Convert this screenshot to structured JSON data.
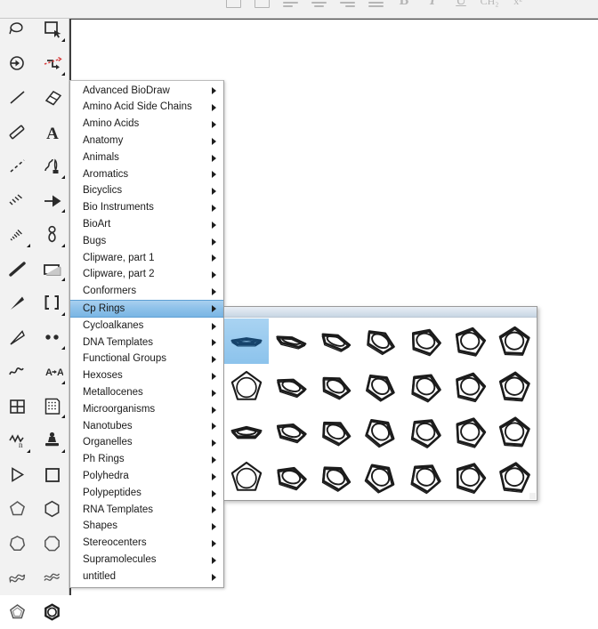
{
  "app": {
    "name": "ChemDraw",
    "accent_selection": "#8fc2ea",
    "menu_bg": "#ffffff",
    "palette_bg": "#f2f2f2"
  },
  "top_toolbar": {
    "name": "text-formatting-toolbar",
    "buttons": [
      {
        "name": "text-box-tool",
        "label": "",
        "icon": "rect-icon"
      },
      {
        "name": "text-box-tool-2",
        "label": "",
        "icon": "rect-icon"
      },
      {
        "name": "align-left-button",
        "label": "",
        "icon": "align-left-icon"
      },
      {
        "name": "align-center-button",
        "label": "",
        "icon": "align-center-icon"
      },
      {
        "name": "align-right-button",
        "label": "",
        "icon": "align-right-icon"
      },
      {
        "name": "align-justify-button",
        "label": "",
        "icon": "align-justify-icon"
      },
      {
        "name": "bold-button",
        "label": "B",
        "icon": "bold-icon"
      },
      {
        "name": "italic-button",
        "label": "I",
        "icon": "italic-icon"
      },
      {
        "name": "underline-button",
        "label": "U",
        "icon": "underline-icon"
      },
      {
        "name": "subscript-button",
        "label": "CH₂",
        "icon": "subscript-icon"
      },
      {
        "name": "superscript-button",
        "label": "x²",
        "icon": "superscript-icon"
      }
    ]
  },
  "left_palette": {
    "name": "main-tool-palette",
    "column_a": [
      {
        "name": "lasso-select-tool",
        "icon": "lasso-icon"
      },
      {
        "name": "structure-perspective-tool",
        "icon": "circle-arrow-icon"
      },
      {
        "name": "solid-bond-tool",
        "icon": "line-icon"
      },
      {
        "name": "multiple-bond-tool",
        "icon": "double-line-icon"
      },
      {
        "name": "dashed-bond-tool",
        "icon": "dashed-line-icon"
      },
      {
        "name": "hashed-bond-tool",
        "icon": "hash-bond-icon"
      },
      {
        "name": "hashed-wedge-bond-tool",
        "icon": "hashed-wedge-icon"
      },
      {
        "name": "bold-bond-tool",
        "icon": "bold-bond-icon"
      },
      {
        "name": "wedged-bond-tool",
        "icon": "wedge-bond-icon"
      },
      {
        "name": "hollow-wedge-bond-tool",
        "icon": "hollow-wedge-icon"
      },
      {
        "name": "wavy-bond-tool",
        "icon": "wavy-bond-icon"
      },
      {
        "name": "table-tool",
        "icon": "table-icon"
      },
      {
        "name": "chain-tool",
        "icon": "chain-icon"
      },
      {
        "name": "arrow-tool",
        "icon": "triangle-right-icon"
      },
      {
        "name": "pentagon-tool",
        "icon": "pentagon-icon"
      },
      {
        "name": "heptagon-tool",
        "icon": "heptagon-icon"
      },
      {
        "name": "ribbon-tool",
        "icon": "ribbon-icon"
      },
      {
        "name": "cyclopentane-tool",
        "icon": "cyclopentane-icon"
      }
    ],
    "column_b": [
      {
        "name": "marquee-select-tool",
        "icon": "marquee-icon"
      },
      {
        "name": "bond-rotate-tool",
        "icon": "rotate-bond-icon"
      },
      {
        "name": "eraser-tool",
        "icon": "eraser-icon"
      },
      {
        "name": "text-tool",
        "icon": "text-a-icon"
      },
      {
        "name": "pen-tool",
        "icon": "pen-icon"
      },
      {
        "name": "arrow-vector-tool",
        "icon": "arrow-icon"
      },
      {
        "name": "orbital-tool",
        "icon": "orbital-icon"
      },
      {
        "name": "bracket-rect-tool",
        "icon": "rectangle-icon"
      },
      {
        "name": "brackets-tool",
        "icon": "brackets-icon"
      },
      {
        "name": "query-dots-tool",
        "icon": "two-dots-icon"
      },
      {
        "name": "atom-label-tool",
        "icon": "a-to-a-icon"
      },
      {
        "name": "template-palette-tool",
        "icon": "template-sheet-icon"
      },
      {
        "name": "stamp-tool",
        "icon": "stamp-icon"
      },
      {
        "name": "square-tool",
        "icon": "square-icon"
      },
      {
        "name": "hexagon-tool",
        "icon": "hexagon-icon"
      },
      {
        "name": "octagon-tool",
        "icon": "octagon-icon"
      },
      {
        "name": "ribbon-flat-tool",
        "icon": "ribbon-flat-icon"
      },
      {
        "name": "benzene-tool",
        "icon": "benzene-icon"
      }
    ]
  },
  "templates_menu": {
    "name": "templates-menu",
    "selected": "Cp Rings",
    "items": [
      {
        "label": "Advanced BioDraw",
        "has_submenu": true
      },
      {
        "label": "Amino Acid Side Chains",
        "has_submenu": true
      },
      {
        "label": "Amino Acids",
        "has_submenu": true
      },
      {
        "label": "Anatomy",
        "has_submenu": true
      },
      {
        "label": "Animals",
        "has_submenu": true
      },
      {
        "label": "Aromatics",
        "has_submenu": true
      },
      {
        "label": "Bicyclics",
        "has_submenu": true
      },
      {
        "label": "Bio Instruments",
        "has_submenu": true
      },
      {
        "label": "BioArt",
        "has_submenu": true
      },
      {
        "label": "Bugs",
        "has_submenu": true
      },
      {
        "label": "Clipware, part 1",
        "has_submenu": true
      },
      {
        "label": "Clipware, part 2",
        "has_submenu": true
      },
      {
        "label": "Conformers",
        "has_submenu": true
      },
      {
        "label": "Cp Rings",
        "has_submenu": true
      },
      {
        "label": "Cycloalkanes",
        "has_submenu": true
      },
      {
        "label": "DNA Templates",
        "has_submenu": true
      },
      {
        "label": "Functional Groups",
        "has_submenu": true
      },
      {
        "label": "Hexoses",
        "has_submenu": true
      },
      {
        "label": "Metallocenes",
        "has_submenu": true
      },
      {
        "label": "Microorganisms",
        "has_submenu": true
      },
      {
        "label": "Nanotubes",
        "has_submenu": true
      },
      {
        "label": "Organelles",
        "has_submenu": true
      },
      {
        "label": "Ph Rings",
        "has_submenu": true
      },
      {
        "label": "Polyhedra",
        "has_submenu": true
      },
      {
        "label": "Polypeptides",
        "has_submenu": true
      },
      {
        "label": "RNA Templates",
        "has_submenu": true
      },
      {
        "label": "Shapes",
        "has_submenu": true
      },
      {
        "label": "Stereocenters",
        "has_submenu": true
      },
      {
        "label": "Supramolecules",
        "has_submenu": true
      },
      {
        "label": "untitled",
        "has_submenu": true
      }
    ]
  },
  "cp_submenu": {
    "name": "cp-rings-template-palette",
    "title": "",
    "selected_index": 0,
    "cells": [
      {
        "name": "cp-ring-0deg",
        "tilt": 78,
        "rot": 0,
        "selected": true
      },
      {
        "name": "cp-ring-a1",
        "tilt": 74,
        "rot": 14,
        "selected": false
      },
      {
        "name": "cp-ring-a2",
        "tilt": 64,
        "rot": 22,
        "selected": false
      },
      {
        "name": "cp-ring-a3",
        "tilt": 50,
        "rot": 32,
        "selected": false
      },
      {
        "name": "cp-ring-a4",
        "tilt": 36,
        "rot": 20,
        "selected": false
      },
      {
        "name": "cp-ring-a5",
        "tilt": 26,
        "rot": 12,
        "selected": false
      },
      {
        "name": "cp-ring-a6",
        "tilt": 20,
        "rot": 2,
        "selected": false
      },
      {
        "name": "cp-ring-b0",
        "tilt": 92,
        "rot": 0,
        "selected": false
      },
      {
        "name": "cp-ring-b1",
        "tilt": 60,
        "rot": 18,
        "selected": false
      },
      {
        "name": "cp-ring-b2",
        "tilt": 52,
        "rot": 26,
        "selected": false
      },
      {
        "name": "cp-ring-b3",
        "tilt": 40,
        "rot": 36,
        "selected": false
      },
      {
        "name": "cp-ring-b4",
        "tilt": 30,
        "rot": 26,
        "selected": false
      },
      {
        "name": "cp-ring-b5",
        "tilt": 24,
        "rot": 14,
        "selected": false
      },
      {
        "name": "cp-ring-b6",
        "tilt": 18,
        "rot": 4,
        "selected": false
      },
      {
        "name": "cp-ring-c0",
        "tilt": 70,
        "rot": 0,
        "selected": false
      },
      {
        "name": "cp-ring-c1",
        "tilt": 58,
        "rot": 16,
        "selected": false
      },
      {
        "name": "cp-ring-c2",
        "tilt": 46,
        "rot": 28,
        "selected": false
      },
      {
        "name": "cp-ring-c3",
        "tilt": 34,
        "rot": 40,
        "selected": false
      },
      {
        "name": "cp-ring-c4",
        "tilt": 26,
        "rot": 28,
        "selected": false
      },
      {
        "name": "cp-ring-c5",
        "tilt": 20,
        "rot": 16,
        "selected": false
      },
      {
        "name": "cp-ring-c6",
        "tilt": 16,
        "rot": 4,
        "selected": false
      },
      {
        "name": "cp-ring-d0",
        "tilt": 94,
        "rot": 0,
        "selected": false
      },
      {
        "name": "cp-ring-d1",
        "tilt": 48,
        "rot": 18,
        "selected": false
      },
      {
        "name": "cp-ring-d2",
        "tilt": 44,
        "rot": 30,
        "selected": false
      },
      {
        "name": "cp-ring-d3",
        "tilt": 30,
        "rot": 42,
        "selected": false
      },
      {
        "name": "cp-ring-d4",
        "tilt": 24,
        "rot": 30,
        "selected": false
      },
      {
        "name": "cp-ring-d5",
        "tilt": 18,
        "rot": 18,
        "selected": false
      },
      {
        "name": "cp-ring-d6",
        "tilt": 14,
        "rot": 6,
        "selected": false
      }
    ]
  }
}
